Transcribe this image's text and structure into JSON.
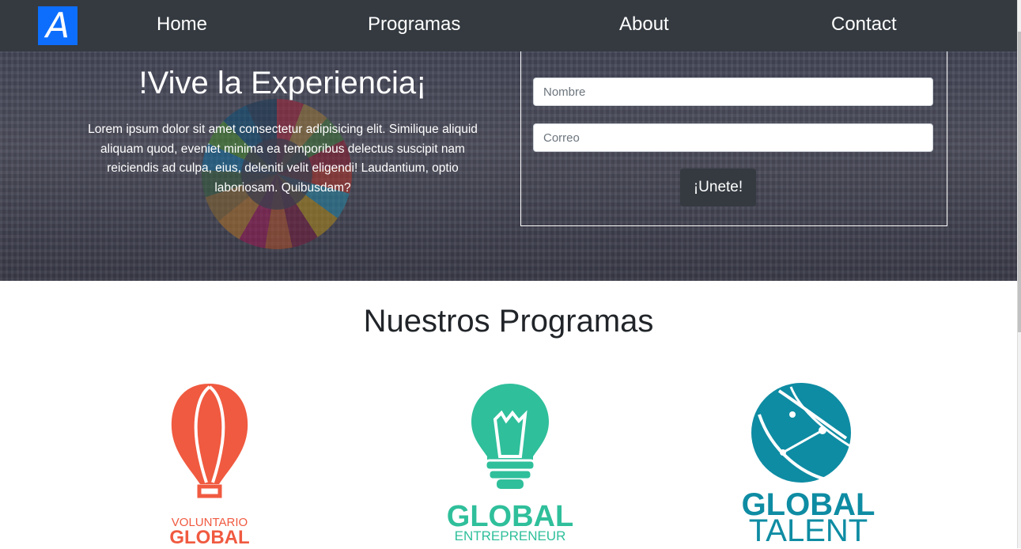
{
  "nav": {
    "logo_letter": "A",
    "links": [
      "Home",
      "Programas",
      "About",
      "Contact"
    ]
  },
  "hero": {
    "title": "!Vive la Experiencia¡",
    "text": "Lorem ipsum dolor sit amet consectetur adipisicing elit. Similique aliquid aliquam quod, eveniet minima ea temporibus delectus suscipit nam reiciendis ad culpa, eius, deleniti velit eligendi! Laudantium, optio laboriosam. Quibusdam?"
  },
  "form": {
    "name_placeholder": "Nombre",
    "email_placeholder": "Correo",
    "submit_label": "¡Unete!"
  },
  "programs": {
    "title": "Nuestros Programas",
    "items": [
      {
        "line1": "VOLUNTARIO",
        "line2": "GLOBAL",
        "color": "#f05a40",
        "icon": "hot-air-balloon-icon"
      },
      {
        "line1": "GLOBAL",
        "line2": "ENTREPRENEUR",
        "color": "#2fbf9b",
        "icon": "lightbulb-icon"
      },
      {
        "line1": "GLOBAL",
        "line2": "TALENT",
        "color": "#0e8ca3",
        "icon": "globe-icon"
      }
    ]
  },
  "colors": {
    "navbar": "#343a40",
    "logo_bg": "#0d6efd"
  }
}
